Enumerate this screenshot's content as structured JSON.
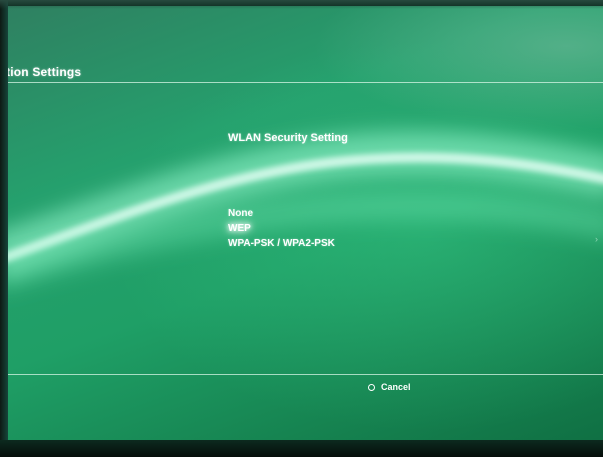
{
  "header": {
    "title": "tion Settings"
  },
  "dialog": {
    "title": "WLAN Security Setting",
    "options": [
      {
        "label": "None",
        "selected": false
      },
      {
        "label": "WEP",
        "selected": true
      },
      {
        "label": "WPA-PSK / WPA2-PSK",
        "selected": false
      }
    ]
  },
  "footer": {
    "cancel_label": "Cancel",
    "cancel_icon": "circle-button-icon"
  },
  "colors": {
    "background": "#1f9f66",
    "text": "#ffffff",
    "divider": "#d7f5e6"
  }
}
